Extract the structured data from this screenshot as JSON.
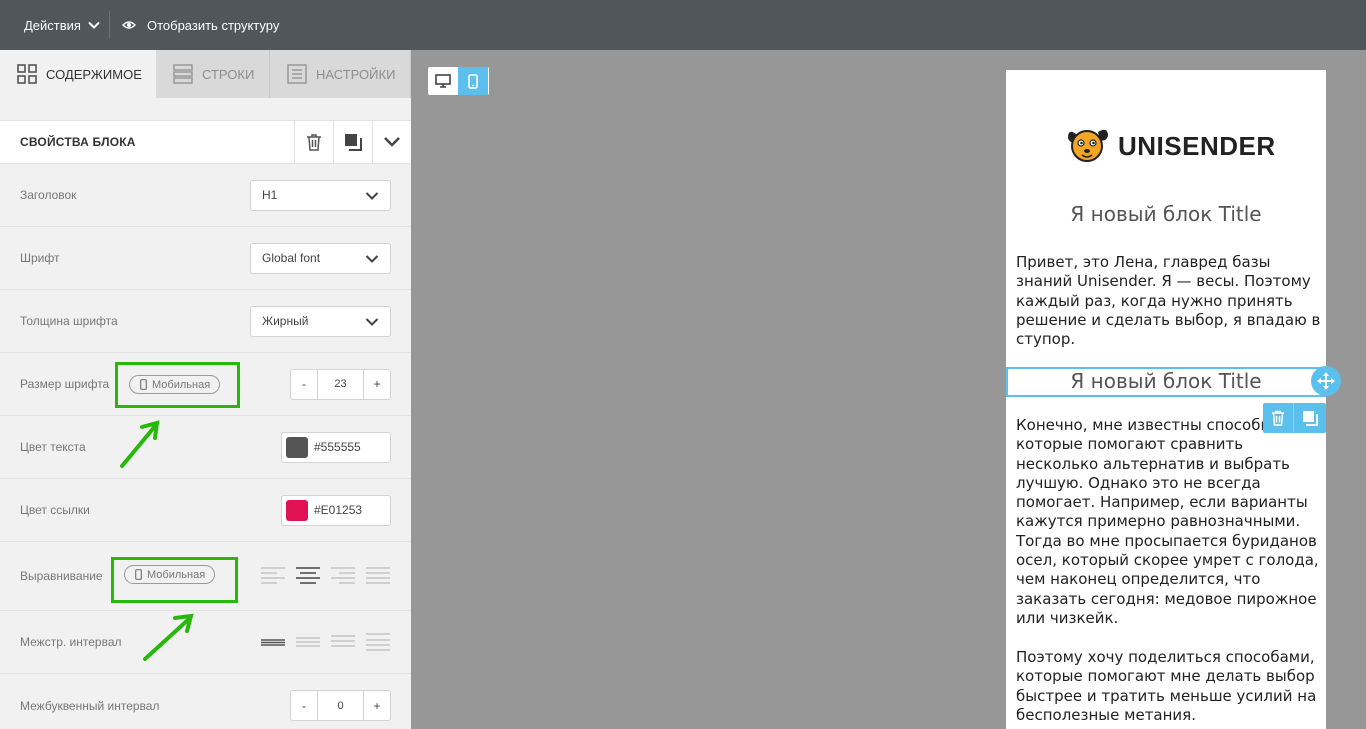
{
  "topbar": {
    "actions_label": "Действия",
    "structure_label": "Отобразить структуру"
  },
  "tabs": [
    {
      "label": "СОДЕРЖИМОЕ",
      "icon": "grid-icon",
      "active": true
    },
    {
      "label": "СТРОКИ",
      "icon": "rows-icon",
      "active": false
    },
    {
      "label": "НАСТРОЙКИ",
      "icon": "settings-doc-icon",
      "active": false
    }
  ],
  "block_props": {
    "title": "СВОЙСТВА БЛОКА",
    "actions": [
      "trash-icon",
      "duplicate-icon",
      "collapse-chevron-icon"
    ]
  },
  "fields": {
    "heading": {
      "label": "Заголовок",
      "value": "H1"
    },
    "font": {
      "label": "Шрифт",
      "value": "Global font"
    },
    "font_weight": {
      "label": "Толщина шрифта",
      "value": "Жирный"
    },
    "font_size": {
      "label": "Размер шрифта",
      "tag": "Мобильная",
      "minus": "-",
      "value": "23",
      "plus": "+"
    },
    "text_color": {
      "label": "Цвет текста",
      "value": "#555555",
      "swatch": "#555555"
    },
    "link_color": {
      "label": "Цвет ссылки",
      "value": "#E01253",
      "swatch": "#E01253"
    },
    "alignment": {
      "label": "Выравнивание",
      "tag": "Мобильная",
      "selected": "center"
    },
    "line_height": {
      "label": "Межстр. интервал"
    },
    "letter_spacing": {
      "label": "Межбуквенный интервал",
      "minus": "-",
      "value": "0",
      "plus": "+"
    }
  },
  "highlight_color": "#27b80a",
  "accent_color": "#5cc0ee",
  "preview": {
    "logo_text": "UNISENDER",
    "title1": "Я новый блок Title",
    "para1": "Привет, это Лена, главред базы знаний Unisender. Я — весы. Поэтому каждый раз, когда нужно принять решение и сделать выбор, я впадаю в ступор.",
    "title2": "Я новый блок Title",
    "para2": "Конечно, мне известны способы, которые помогают сравнить несколько альтернатив и выбрать лучшую. Однако это не всегда помогает. Например, если варианты кажутся примерно равнозначными. Тогда во мне просыпается буриданов осел, который скорее умрет с голода, чем наконец определится, что заказать сегодня: медовое пирожное или чизкейк.",
    "para3": "Поэтому хочу поделиться способами, которые помогают мне делать выбор быстрее и тратить меньше усилий на бесполезные метания."
  }
}
